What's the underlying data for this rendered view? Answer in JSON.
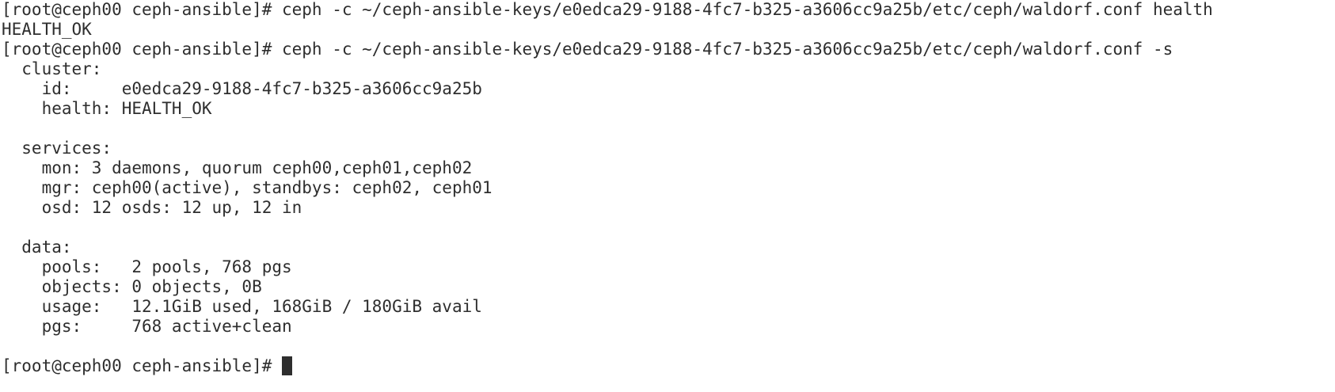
{
  "colors": {
    "background": "#ffffff",
    "foreground": "#2e2e2e",
    "cursor": "#2e2e2e"
  },
  "terminal": {
    "lines": [
      "[root@ceph00 ceph-ansible]# ceph -c ~/ceph-ansible-keys/e0edca29-9188-4fc7-b325-a3606cc9a25b/etc/ceph/waldorf.conf health",
      "HEALTH_OK",
      "[root@ceph00 ceph-ansible]# ceph -c ~/ceph-ansible-keys/e0edca29-9188-4fc7-b325-a3606cc9a25b/etc/ceph/waldorf.conf -s",
      "  cluster:",
      "    id:     e0edca29-9188-4fc7-b325-a3606cc9a25b",
      "    health: HEALTH_OK",
      "",
      "  services:",
      "    mon: 3 daemons, quorum ceph00,ceph01,ceph02",
      "    mgr: ceph00(active), standbys: ceph02, ceph01",
      "    osd: 12 osds: 12 up, 12 in",
      "",
      "  data:",
      "    pools:   2 pools, 768 pgs",
      "    objects: 0 objects, 0B",
      "    usage:   12.1GiB used, 168GiB / 180GiB avail",
      "    pgs:     768 active+clean",
      ""
    ],
    "prompt": "[root@ceph00 ceph-ansible]# "
  }
}
